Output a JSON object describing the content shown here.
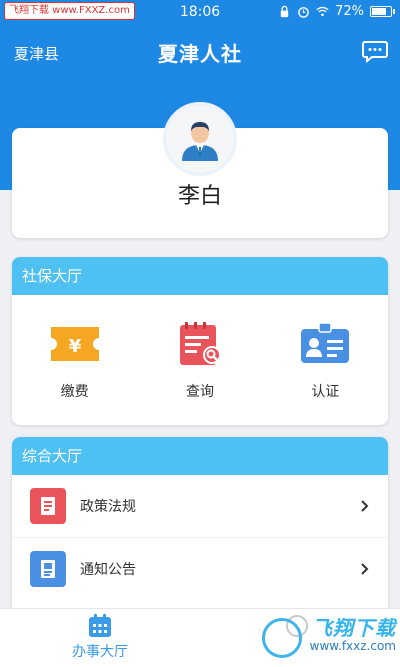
{
  "status_bar": {
    "watermark": "飞翔下载 www.FXXZ.com",
    "time": "18:06",
    "battery": "72%"
  },
  "header": {
    "location": "夏津县",
    "title": "夏津人社"
  },
  "profile": {
    "name": "李白"
  },
  "social_hall": {
    "title": "社保大厅",
    "items": [
      {
        "label": "缴费",
        "icon": "yen-ticket-icon",
        "color": "#f5a623"
      },
      {
        "label": "查询",
        "icon": "search-notepad-icon",
        "color": "#e9535a"
      },
      {
        "label": "认证",
        "icon": "id-card-icon",
        "color": "#4a90e2"
      }
    ]
  },
  "general_hall": {
    "title": "综合大厅",
    "items": [
      {
        "label": "政策法规",
        "icon": "notebook-icon",
        "color": "#e9535a"
      },
      {
        "label": "通知公告",
        "icon": "document-icon",
        "color": "#4a90e2"
      }
    ]
  },
  "tabbar": {
    "active_label": "办事大厅"
  },
  "brand_watermark": {
    "title": "飞翔下载",
    "url": "www.fxxz.com"
  },
  "colors": {
    "header_blue": "#1e88e5",
    "section_blue": "#4fc0f2",
    "tab_active": "#3a9be8"
  }
}
